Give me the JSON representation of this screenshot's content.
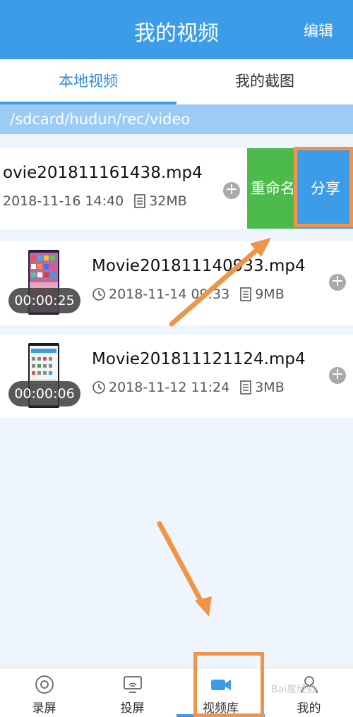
{
  "header": {
    "title": "我的视频",
    "edit_label": "编辑"
  },
  "tabs": [
    {
      "label": "本地视频",
      "active": true
    },
    {
      "label": "我的截图",
      "active": false
    }
  ],
  "path": "/sdcard/hudun/rec/video",
  "videos": [
    {
      "name": "ovie201811161438.mp4",
      "date": "2018-11-16 14:40",
      "size": "32MB",
      "duration": ""
    },
    {
      "name": "Movie201811140933.mp4",
      "date": "2018-11-14 09:33",
      "size": "9MB",
      "duration": "00:00:25"
    },
    {
      "name": "Movie201811121124.mp4",
      "date": "2018-11-12 11:24",
      "size": "3MB",
      "duration": "00:00:06"
    }
  ],
  "swipe_actions": {
    "rename_label": "重命名",
    "share_label": "分享"
  },
  "bottom_nav": [
    {
      "label": "录屏",
      "icon": "record-icon",
      "active": false
    },
    {
      "label": "投屏",
      "icon": "cast-icon",
      "active": false
    },
    {
      "label": "视频库",
      "icon": "video-camera-icon",
      "active": true
    },
    {
      "label": "我的",
      "icon": "user-icon",
      "active": false
    }
  ],
  "colors": {
    "primary": "#3d9ce8",
    "rename": "#4cbb4c",
    "highlight": "#f0944a"
  }
}
